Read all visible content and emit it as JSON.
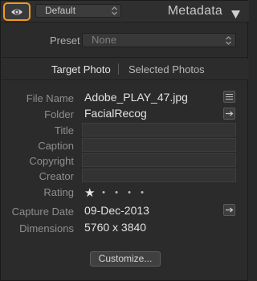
{
  "header": {
    "title": "Metadata",
    "preset_value": "Default",
    "eye_icon": "eye-icon",
    "collapse_icon": "triangle-down-icon",
    "accent_color": "#f29a1f"
  },
  "preset": {
    "label": "Preset",
    "value": "None"
  },
  "tabs": [
    {
      "label": "Target Photo",
      "active": true
    },
    {
      "label": "Selected Photos",
      "active": false
    }
  ],
  "fields": {
    "file_name": {
      "label": "File Name",
      "value": "Adobe_PLAY_47.jpg"
    },
    "folder": {
      "label": "Folder",
      "value": "FacialRecog"
    },
    "title": {
      "label": "Title",
      "value": ""
    },
    "caption": {
      "label": "Caption",
      "value": ""
    },
    "copyright": {
      "label": "Copyright",
      "value": ""
    },
    "creator": {
      "label": "Creator",
      "value": ""
    },
    "rating": {
      "label": "Rating",
      "stars": 1,
      "max": 5
    },
    "capture_date": {
      "label": "Capture Date",
      "value": "09-Dec-2013"
    },
    "dimensions": {
      "label": "Dimensions",
      "value": "5760 x 3840"
    }
  },
  "customize_label": "Customize..."
}
